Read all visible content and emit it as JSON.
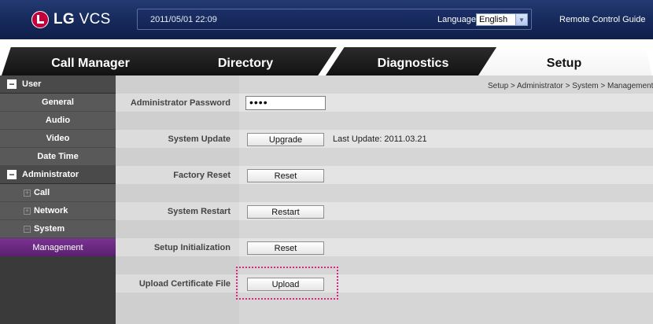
{
  "header": {
    "brand_lg": "LG",
    "brand_vcs": "VCS",
    "datetime": "2011/05/01 22:09",
    "language_label": "Language",
    "language_value": "English",
    "remote_guide": "Remote Control Guide"
  },
  "tabs": [
    {
      "label": "Call Manager"
    },
    {
      "label": "Directory"
    },
    {
      "label": "Diagnostics"
    },
    {
      "label": "Setup"
    }
  ],
  "sidebar": {
    "user": "User",
    "general": "General",
    "audio": "Audio",
    "video": "Video",
    "date_time": "Date Time",
    "administrator": "Administrator",
    "call": "Call",
    "network": "Network",
    "system": "System",
    "management": "Management"
  },
  "breadcrumb": "Setup > Administrator > System > Management",
  "rows": {
    "admin_password_label": "Administrator Password",
    "admin_password_value": "••••",
    "system_update_label": "System Update",
    "upgrade_button": "Upgrade",
    "last_update": "Last Update: 2011.03.21",
    "factory_reset_label": "Factory Reset",
    "factory_reset_button": "Reset",
    "system_restart_label": "System Restart",
    "restart_button": "Restart",
    "setup_init_label": "Setup Initialization",
    "setup_init_button": "Reset",
    "upload_cert_label": "Upload Certificate File",
    "upload_button": "Upload"
  },
  "colors": {
    "header_bg": "#162a5c",
    "active_sidebar": "#6a2882",
    "highlight_border": "#e0208a"
  }
}
